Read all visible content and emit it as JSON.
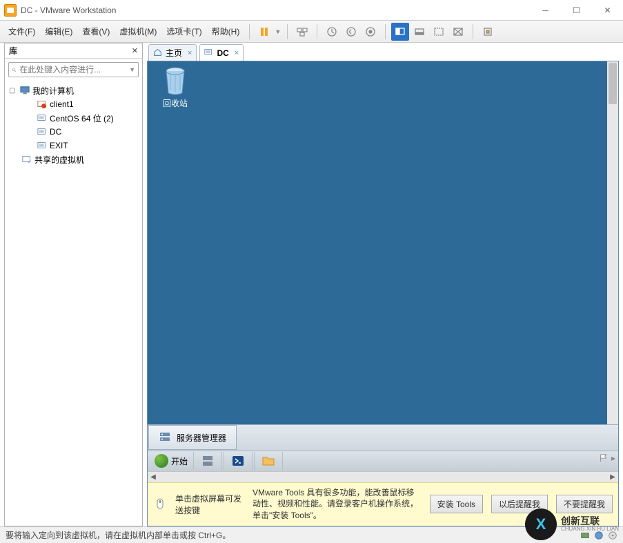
{
  "window": {
    "title": "DC - VMware Workstation"
  },
  "menu": {
    "file": "文件(F)",
    "edit": "编辑(E)",
    "view": "查看(V)",
    "vm": "虚拟机(M)",
    "tabs": "选项卡(T)",
    "help": "帮助(H)"
  },
  "library": {
    "title": "库",
    "search_placeholder": "在此处键入内容进行...",
    "tree": {
      "my_computer": "我的计算机",
      "vm1": "client1",
      "vm2": "CentOS 64 位 (2)",
      "vm3": "DC",
      "vm4": "EXIT",
      "shared": "共享的虚拟机"
    }
  },
  "tabs": {
    "home": "主页",
    "dc": "DC"
  },
  "guest": {
    "recycle_bin": "回收站",
    "server_manager": "服务器管理器",
    "start": "开始"
  },
  "infobar": {
    "hint1": "单击虚拟屏幕可发送按键",
    "hint2": "VMware Tools 具有很多功能，能改善鼠标移动性、视频和性能。请登录客户机操作系统，单击\"安装 Tools\"。",
    "btn_install": "安装 Tools",
    "btn_later": "以后提醒我",
    "btn_never": "不要提醒我"
  },
  "status": {
    "text": "要将输入定向到该虚拟机，请在虚拟机内部单击或按 Ctrl+G。"
  },
  "watermark": {
    "line1": "创新互联",
    "line2": "CHUANG XIN HU LIAN"
  }
}
